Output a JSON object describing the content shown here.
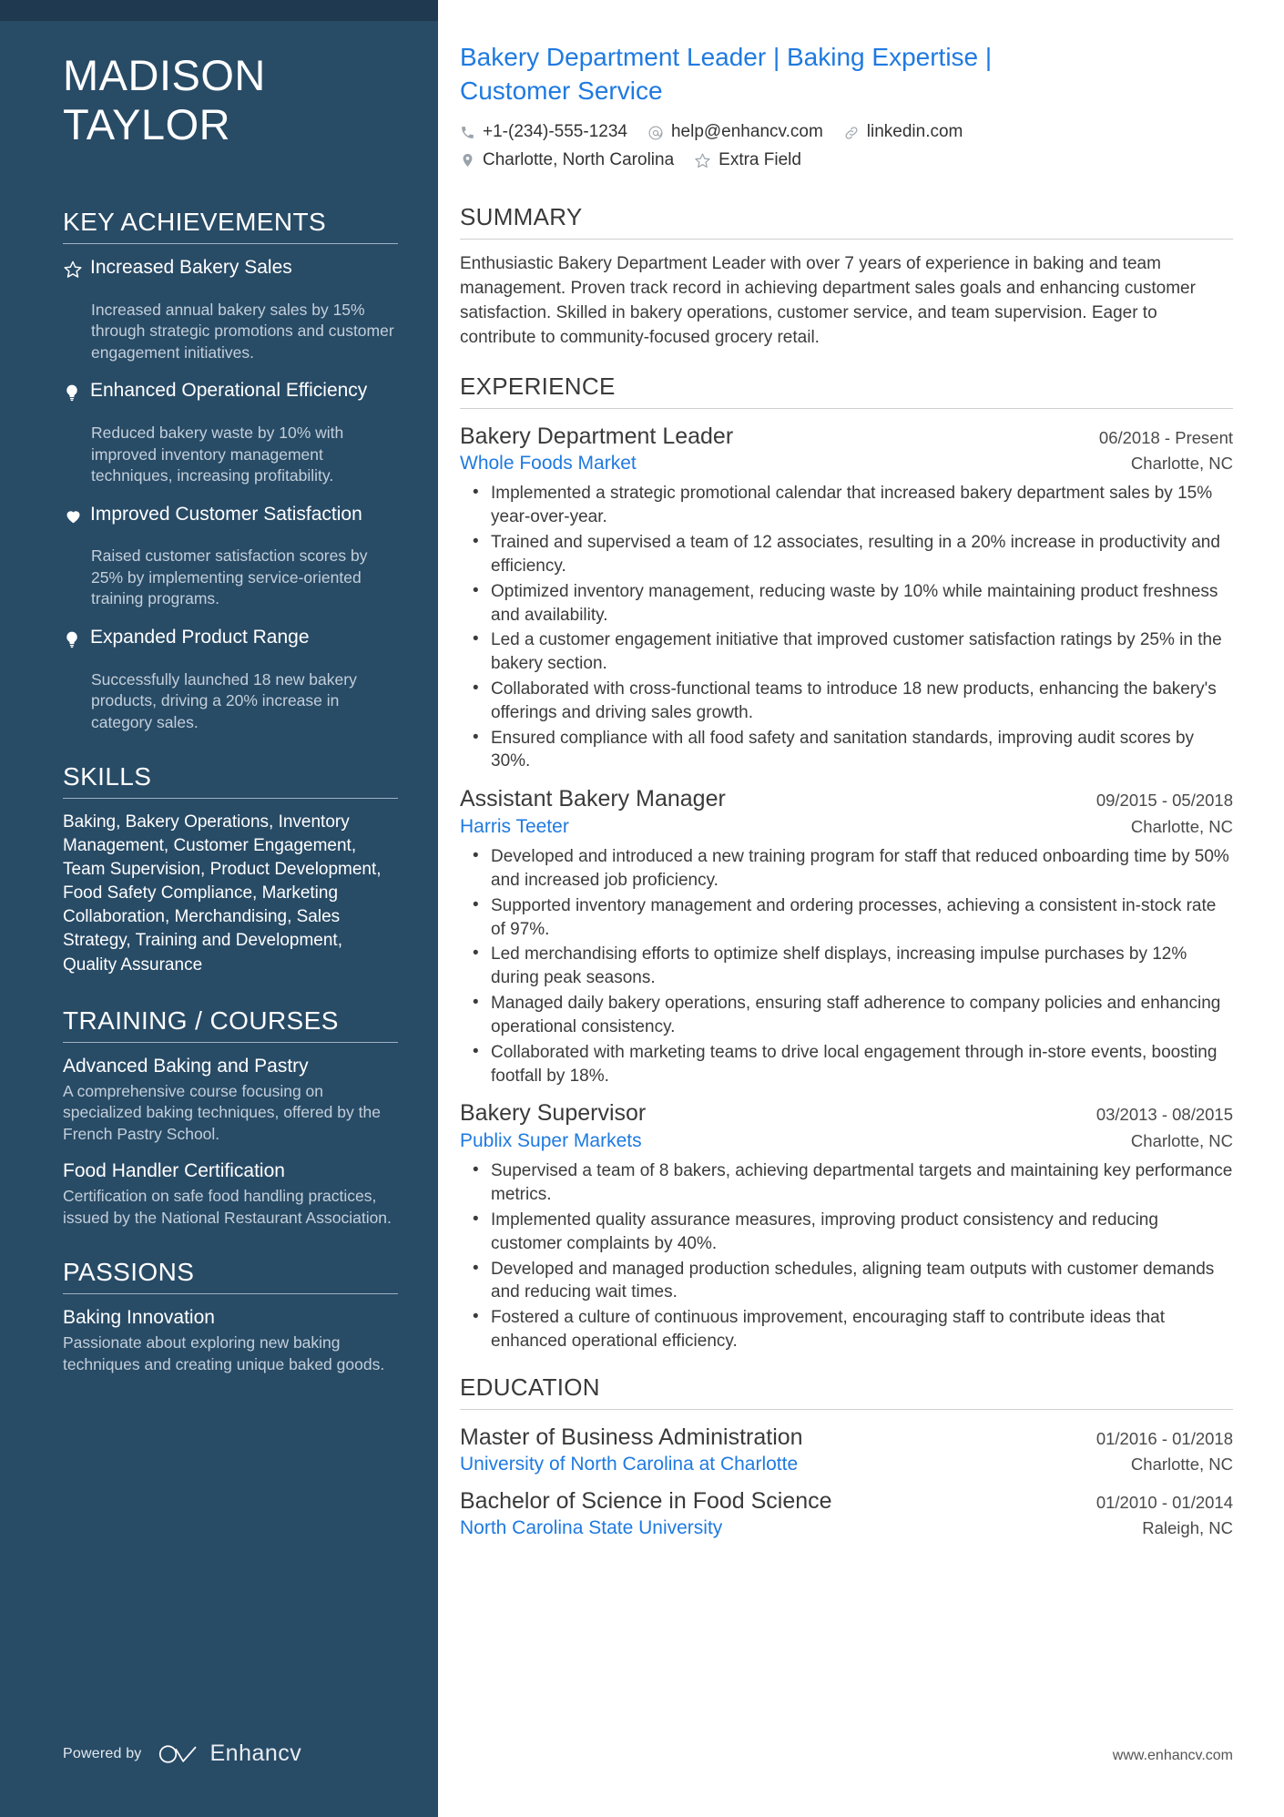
{
  "sidebar": {
    "name": "MADISON\nTAYLOR",
    "name_line1": "MADISON",
    "name_line2": "TAYLOR",
    "sections": {
      "achievements_heading": "KEY ACHIEVEMENTS",
      "skills_heading": "SKILLS",
      "training_heading": "TRAINING / COURSES",
      "passions_heading": "PASSIONS"
    },
    "achievements": [
      {
        "icon": "star-icon",
        "title": "Increased Bakery Sales",
        "description": "Increased annual bakery sales by 15% through strategic promotions and customer engagement initiatives."
      },
      {
        "icon": "lightbulb-icon",
        "title": "Enhanced Operational Efficiency",
        "description": "Reduced bakery waste by 10% with improved inventory management techniques, increasing profitability."
      },
      {
        "icon": "heart-icon",
        "title": "Improved Customer Satisfaction",
        "description": "Raised customer satisfaction scores by 25% by implementing service-oriented training programs."
      },
      {
        "icon": "lightbulb-icon",
        "title": "Expanded Product Range",
        "description": "Successfully launched 18 new bakery products, driving a 20% increase in category sales."
      }
    ],
    "skills_text": "Baking, Bakery Operations, Inventory Management, Customer Engagement, Team Supervision, Product Development, Food Safety Compliance, Marketing Collaboration, Merchandising, Sales Strategy, Training and Development, Quality Assurance",
    "courses": [
      {
        "title": "Advanced Baking and Pastry",
        "description": "A comprehensive course focusing on specialized baking techniques, offered by the French Pastry School."
      },
      {
        "title": "Food Handler Certification",
        "description": "Certification on safe food handling practices, issued by the National Restaurant Association."
      }
    ],
    "passions": [
      {
        "title": "Baking Innovation",
        "description": "Passionate about exploring new baking techniques and creating unique baked goods."
      }
    ],
    "footer": {
      "powered_by": "Powered by",
      "brand": "Enhancv"
    }
  },
  "main": {
    "headline": "Bakery Department Leader | Baking Expertise | Customer Service",
    "contacts_row1": [
      {
        "icon": "phone-icon",
        "text": "+1-(234)-555-1234"
      },
      {
        "icon": "email-icon",
        "text": "help@enhancv.com"
      },
      {
        "icon": "link-icon",
        "text": "linkedin.com"
      }
    ],
    "contacts_row2": [
      {
        "icon": "location-pin-icon",
        "text": "Charlotte, North Carolina"
      },
      {
        "icon": "star-outline-icon",
        "text": "Extra Field"
      }
    ],
    "summary_heading": "SUMMARY",
    "summary_text": "Enthusiastic Bakery Department Leader with over 7 years of experience in baking and team management. Proven track record in achieving department sales goals and enhancing customer satisfaction. Skilled in bakery operations, customer service, and team supervision. Eager to contribute to community-focused grocery retail.",
    "experience_heading": "EXPERIENCE",
    "experience": [
      {
        "title": "Bakery Department Leader",
        "date": "06/2018 - Present",
        "company": "Whole Foods Market",
        "location": "Charlotte, NC",
        "bullets": [
          "Implemented a strategic promotional calendar that increased bakery department sales by 15% year-over-year.",
          "Trained and supervised a team of 12 associates, resulting in a 20% increase in productivity and efficiency.",
          "Optimized inventory management, reducing waste by 10% while maintaining product freshness and availability.",
          "Led a customer engagement initiative that improved customer satisfaction ratings by 25% in the bakery section.",
          "Collaborated with cross-functional teams to introduce 18 new products, enhancing the bakery's offerings and driving sales growth.",
          "Ensured compliance with all food safety and sanitation standards, improving audit scores by 30%."
        ]
      },
      {
        "title": "Assistant Bakery Manager",
        "date": "09/2015 - 05/2018",
        "company": "Harris Teeter",
        "location": "Charlotte, NC",
        "bullets": [
          "Developed and introduced a new training program for staff that reduced onboarding time by 50% and increased job proficiency.",
          "Supported inventory management and ordering processes, achieving a consistent in-stock rate of 97%.",
          "Led merchandising efforts to optimize shelf displays, increasing impulse purchases by 12% during peak seasons.",
          "Managed daily bakery operations, ensuring staff adherence to company policies and enhancing operational consistency.",
          "Collaborated with marketing teams to drive local engagement through in-store events, boosting footfall by 18%."
        ]
      },
      {
        "title": "Bakery Supervisor",
        "date": "03/2013 - 08/2015",
        "company": "Publix Super Markets",
        "location": "Charlotte, NC",
        "bullets": [
          "Supervised a team of 8 bakers, achieving departmental targets and maintaining key performance metrics.",
          "Implemented quality assurance measures, improving product consistency and reducing customer complaints by 40%.",
          "Developed and managed production schedules, aligning team outputs with customer demands and reducing wait times.",
          "Fostered a culture of continuous improvement, encouraging staff to contribute ideas that enhanced operational efficiency."
        ]
      }
    ],
    "education_heading": "EDUCATION",
    "education": [
      {
        "degree": "Master of Business Administration",
        "date": "01/2016 - 01/2018",
        "school": "University of North Carolina at Charlotte",
        "location": "Charlotte, NC"
      },
      {
        "degree": "Bachelor of Science in Food Science",
        "date": "01/2010 - 01/2014",
        "school": "North Carolina State University",
        "location": "Raleigh, NC"
      }
    ],
    "footer_url": "www.enhancv.com"
  },
  "colors": {
    "sidebar_bg": "#284b66",
    "sidebar_topbar": "#1e3950",
    "accent_blue": "#1f7ae0",
    "muted_text": "#c3cfda"
  }
}
